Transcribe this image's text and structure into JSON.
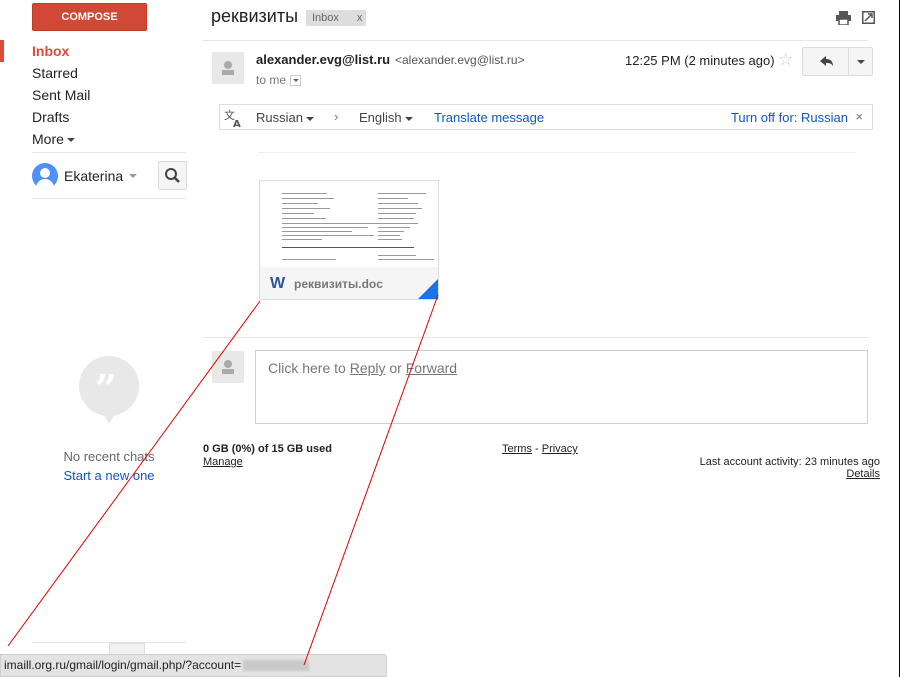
{
  "nav": {
    "compose": "COMPOSE",
    "items": [
      {
        "label": "Inbox",
        "active": true
      },
      {
        "label": "Starred"
      },
      {
        "label": "Sent Mail"
      },
      {
        "label": "Drafts"
      },
      {
        "label": "More"
      }
    ]
  },
  "hangouts": {
    "user_name": "Ekaterina",
    "no_chats": "No recent chats",
    "start_chat": "Start a new one"
  },
  "header": {
    "subject": "реквизиты",
    "label": "Inbox",
    "label_close": "x"
  },
  "message": {
    "sender_name": "alexander.evg@list.ru",
    "sender_email": "<alexander.evg@list.ru>",
    "to": "to me",
    "time": "12:25 PM (2 minutes ago)"
  },
  "translate": {
    "source_lang": "Russian",
    "arrow": "›",
    "target_lang": "English",
    "translate_link": "Translate message",
    "turn_off": "Turn off for: Russian",
    "close": "×"
  },
  "attachment": {
    "type_letter": "W",
    "filename": "реквизиты.doc",
    "accent_color": "#1a73e8"
  },
  "reply": {
    "prefix": "Click here to ",
    "reply_link": "Reply",
    "or": " or ",
    "forward_link": "Forward"
  },
  "footer": {
    "storage": "0 GB (0%) of 15 GB used",
    "manage": "Manage",
    "terms": "Terms",
    "dash": " - ",
    "privacy": "Privacy",
    "last_activity": "Last account activity: 23 minutes ago",
    "details": "Details"
  },
  "status_bar": {
    "url": "imaill.org.ru/gmail/login/gmail.php/?account="
  },
  "colors": {
    "compose": "#d14836",
    "link": "#1155cc",
    "active_nav": "#dd4b39",
    "annotation": "#e00000"
  }
}
